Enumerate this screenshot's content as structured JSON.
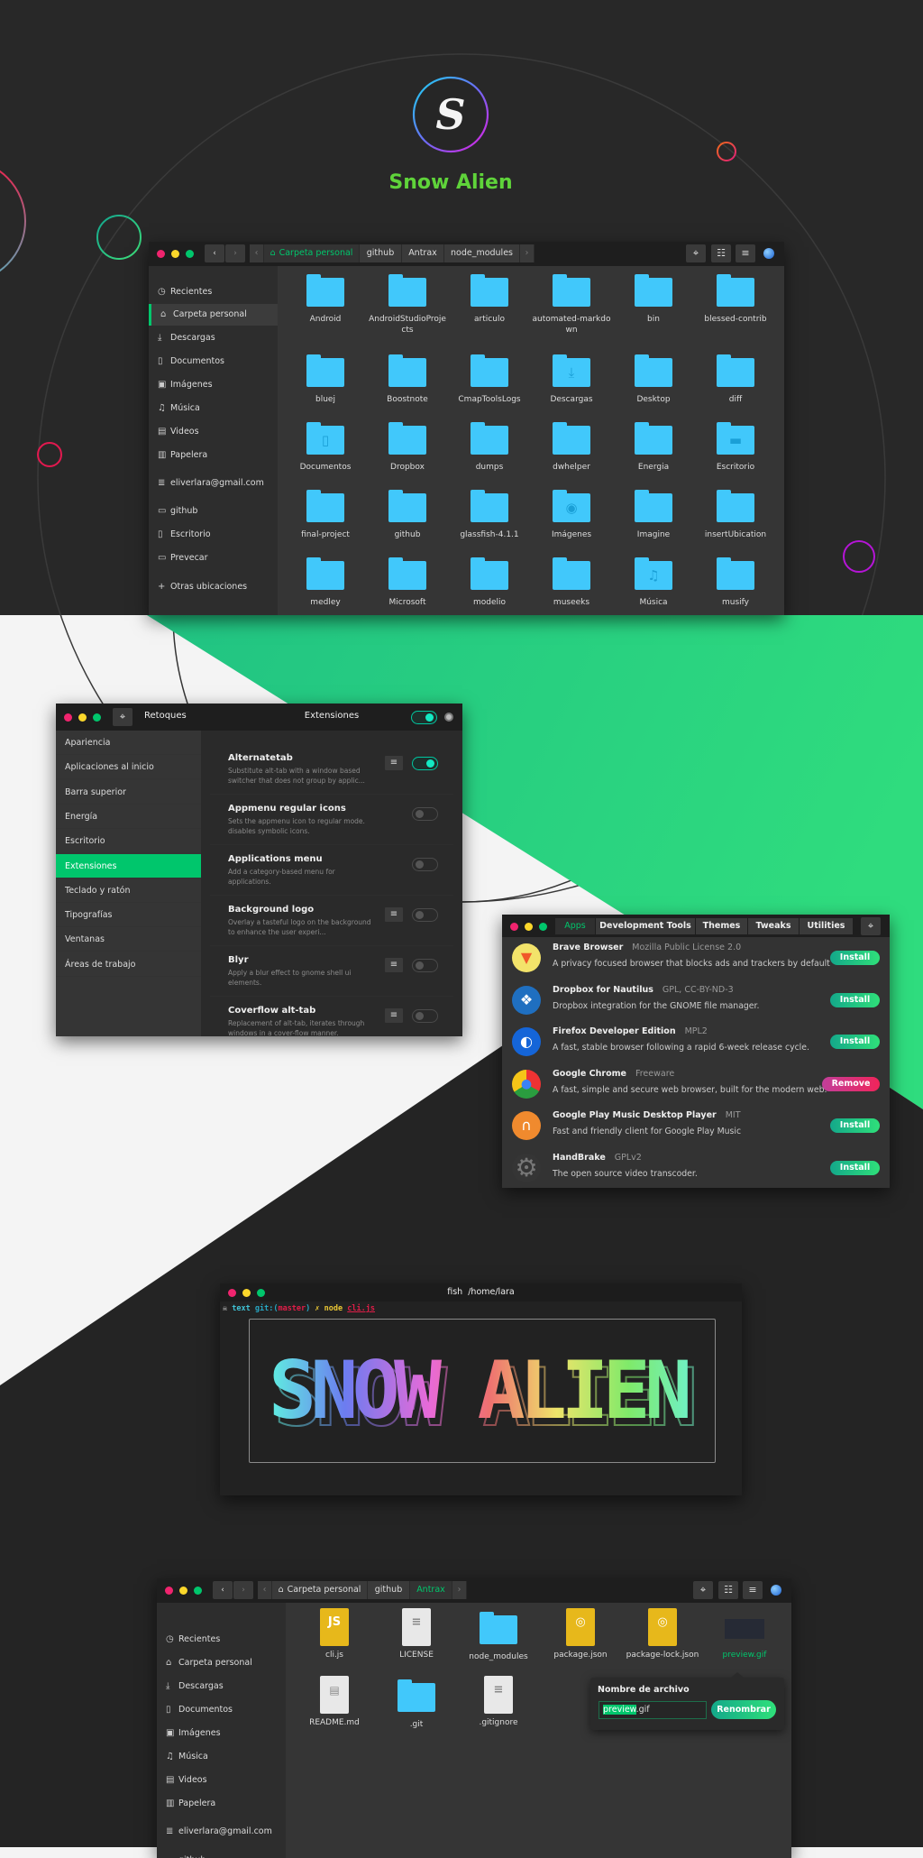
{
  "brand": {
    "logo_letter": "S",
    "title": "Snow Alien",
    "accent": "#5fd33a"
  },
  "colors": {
    "green": "#00c66c",
    "folder": "#41c8fb",
    "close": "#f0246e",
    "minimize": "#fbd72b",
    "maximize": "#00c66c"
  },
  "files1": {
    "path": [
      "Carpeta personal",
      "github",
      "Antrax",
      "node_modules"
    ],
    "active_path": 0,
    "sidebar": [
      {
        "icon": "clock-icon",
        "label": "Recientes"
      },
      {
        "icon": "home-icon",
        "label": "Carpeta personal",
        "selected": true
      },
      {
        "icon": "download-icon",
        "label": "Descargas"
      },
      {
        "icon": "document-icon",
        "label": "Documentos"
      },
      {
        "icon": "image-icon",
        "label": "Imágenes"
      },
      {
        "icon": "music-icon",
        "label": "Música"
      },
      {
        "icon": "film-icon",
        "label": "Videos"
      },
      {
        "icon": "trash-icon",
        "label": "Papelera"
      },
      {
        "icon": "account-icon",
        "label": "eliverlara@gmail.com"
      },
      {
        "icon": "folder-bookmark-icon",
        "label": "github"
      },
      {
        "icon": "document-icon",
        "label": "Escritorio"
      },
      {
        "icon": "folder-bookmark-icon",
        "label": "Prevecar"
      },
      {
        "icon": "plus-icon",
        "label": "Otras ubicaciones"
      }
    ],
    "items": [
      {
        "name": "Android"
      },
      {
        "name": "AndroidStudioProjects"
      },
      {
        "name": "articulo"
      },
      {
        "name": "automated-markdown"
      },
      {
        "name": "bin"
      },
      {
        "name": "blessed-contrib"
      },
      {
        "name": "bluej"
      },
      {
        "name": "Boostnote"
      },
      {
        "name": "CmapToolsLogs"
      },
      {
        "name": "Descargas",
        "overlay": "download-icon"
      },
      {
        "name": "Desktop"
      },
      {
        "name": "diff"
      },
      {
        "name": "Documentos",
        "overlay": "document-icon"
      },
      {
        "name": "Dropbox"
      },
      {
        "name": "dumps"
      },
      {
        "name": "dwhelper"
      },
      {
        "name": "Energia"
      },
      {
        "name": "Escritorio",
        "overlay": "desktop-icon"
      },
      {
        "name": "final-project"
      },
      {
        "name": "github"
      },
      {
        "name": "glassfish-4.1.1"
      },
      {
        "name": "Imágenes",
        "overlay": "camera-icon"
      },
      {
        "name": "Imagine"
      },
      {
        "name": "insertUbication"
      },
      {
        "name": "medley"
      },
      {
        "name": "Microsoft"
      },
      {
        "name": "modelio"
      },
      {
        "name": "museeks"
      },
      {
        "name": "Música",
        "overlay": "music-icon"
      },
      {
        "name": "musify"
      }
    ]
  },
  "tweaks": {
    "app_title": "Retoques",
    "section_title": "Extensiones",
    "master_toggle_on": true,
    "sidebar": [
      "Apariencia",
      "Aplicaciones al inicio",
      "Barra superior",
      "Energía",
      "Escritorio",
      "Extensiones",
      "Teclado y ratón",
      "Tipografías",
      "Ventanas",
      "Áreas de trabajo"
    ],
    "selected": 5,
    "extensions": [
      {
        "title": "Alternatetab",
        "desc": "Substitute alt-tab with a window based switcher that does not group by applic...",
        "settings": true,
        "on": true
      },
      {
        "title": "Appmenu regular icons",
        "desc": "Sets the appmenu icon to regular mode. disables symbolic icons.",
        "settings": false,
        "on": false
      },
      {
        "title": "Applications menu",
        "desc": "Add a category-based menu for applications.",
        "settings": false,
        "on": false
      },
      {
        "title": "Background logo",
        "desc": "Overlay a tasteful logo on the background to enhance the user experi...",
        "settings": true,
        "on": false
      },
      {
        "title": "Blyr",
        "desc": "Apply a blur effect to gnome shell ui elements.",
        "settings": true,
        "on": false
      },
      {
        "title": "Coverflow alt-tab",
        "desc": "Replacement of alt-tab, iterates through windows in a cover-flow manner.",
        "settings": true,
        "on": false
      }
    ]
  },
  "store": {
    "tabs": [
      "Apps",
      "Development Tools",
      "Themes",
      "Tweaks",
      "Utilities"
    ],
    "active_tab": 0,
    "apps": [
      {
        "name": "Brave Browser",
        "license": "Mozilla Public License 2.0",
        "desc": "A privacy focused browser that blocks ads and trackers by default",
        "action": "Install",
        "icon": "brave-icon",
        "color": "#f3e36a"
      },
      {
        "name": "Dropbox for Nautilus",
        "license": "GPL, CC-BY-ND-3",
        "desc": "Dropbox integration for the GNOME file manager.",
        "action": "Install",
        "icon": "dropbox-icon",
        "color": "#1f6fc0"
      },
      {
        "name": "Firefox Developer Edition",
        "license": "MPL2",
        "desc": "A fast, stable browser following a rapid 6-week release cycle.",
        "action": "Install",
        "icon": "firefox-icon",
        "color": "#1565d8"
      },
      {
        "name": "Google Chrome",
        "license": "Freeware",
        "desc": "A fast, simple and secure web browser, built for the modern web.",
        "action": "Remove",
        "icon": "chrome-icon",
        "color": "#e0e0e0"
      },
      {
        "name": "Google Play Music Desktop Player",
        "license": "MIT",
        "desc": "Fast and friendly client for Google Play Music",
        "action": "Install",
        "icon": "headphones-icon",
        "color": "#f08a2e"
      },
      {
        "name": "HandBrake",
        "license": "GPLv2",
        "desc": "The open source video transcoder.",
        "action": "Install",
        "icon": "gears-icon",
        "color": "#353535"
      }
    ]
  },
  "terminal": {
    "title": "fish  /home/lara",
    "prompt": {
      "dir": "text",
      "git_open": "git:(",
      "branch": "master",
      "git_close": ")",
      "mark": "✗",
      "cmd": "node",
      "arg": "cli.js"
    },
    "banner": "SNOW ALIEN"
  },
  "files2": {
    "path": [
      "Carpeta personal",
      "github",
      "Antrax"
    ],
    "active_path": 2,
    "sidebar": [
      {
        "icon": "clock-icon",
        "label": "Recientes"
      },
      {
        "icon": "home-icon",
        "label": "Carpeta personal"
      },
      {
        "icon": "download-icon",
        "label": "Descargas"
      },
      {
        "icon": "document-icon",
        "label": "Documentos"
      },
      {
        "icon": "image-icon",
        "label": "Imágenes"
      },
      {
        "icon": "music-icon",
        "label": "Música"
      },
      {
        "icon": "film-icon",
        "label": "Videos"
      },
      {
        "icon": "trash-icon",
        "label": "Papelera"
      },
      {
        "icon": "account-icon",
        "label": "eliverlara@gmail.com"
      },
      {
        "icon": "folder-bookmark-icon",
        "label": "github"
      }
    ],
    "items": [
      {
        "name": "cli.js",
        "type": "js",
        "badge": "JS"
      },
      {
        "name": "LICENSE",
        "type": "text"
      },
      {
        "name": "node_modules",
        "type": "folder"
      },
      {
        "name": "package.json",
        "type": "pk"
      },
      {
        "name": "package-lock.json",
        "type": "pk"
      },
      {
        "name": "preview.gif",
        "type": "gif",
        "selected": true
      },
      {
        "name": "README.md",
        "type": "doc"
      },
      {
        "name": ".git",
        "type": "folder"
      },
      {
        "name": ".gitignore",
        "type": "text"
      }
    ],
    "rename": {
      "label": "Nombre de archivo",
      "value_selected": "preview",
      "value_rest": ".gif",
      "button": "Renombrar"
    }
  }
}
